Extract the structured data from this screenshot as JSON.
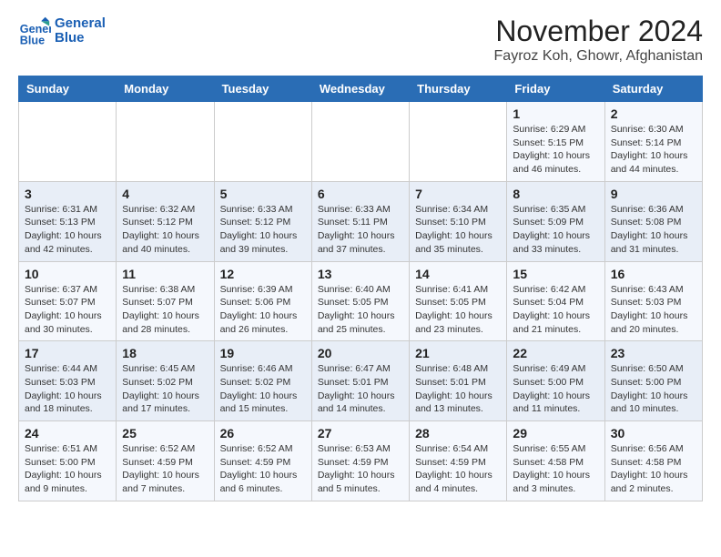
{
  "logo": {
    "line1": "General",
    "line2": "Blue"
  },
  "title": "November 2024",
  "location": "Fayroz Koh, Ghowr, Afghanistan",
  "days_of_week": [
    "Sunday",
    "Monday",
    "Tuesday",
    "Wednesday",
    "Thursday",
    "Friday",
    "Saturday"
  ],
  "weeks": [
    [
      {
        "day": "",
        "info": ""
      },
      {
        "day": "",
        "info": ""
      },
      {
        "day": "",
        "info": ""
      },
      {
        "day": "",
        "info": ""
      },
      {
        "day": "",
        "info": ""
      },
      {
        "day": "1",
        "info": "Sunrise: 6:29 AM\nSunset: 5:15 PM\nDaylight: 10 hours and 46 minutes."
      },
      {
        "day": "2",
        "info": "Sunrise: 6:30 AM\nSunset: 5:14 PM\nDaylight: 10 hours and 44 minutes."
      }
    ],
    [
      {
        "day": "3",
        "info": "Sunrise: 6:31 AM\nSunset: 5:13 PM\nDaylight: 10 hours and 42 minutes."
      },
      {
        "day": "4",
        "info": "Sunrise: 6:32 AM\nSunset: 5:12 PM\nDaylight: 10 hours and 40 minutes."
      },
      {
        "day": "5",
        "info": "Sunrise: 6:33 AM\nSunset: 5:12 PM\nDaylight: 10 hours and 39 minutes."
      },
      {
        "day": "6",
        "info": "Sunrise: 6:33 AM\nSunset: 5:11 PM\nDaylight: 10 hours and 37 minutes."
      },
      {
        "day": "7",
        "info": "Sunrise: 6:34 AM\nSunset: 5:10 PM\nDaylight: 10 hours and 35 minutes."
      },
      {
        "day": "8",
        "info": "Sunrise: 6:35 AM\nSunset: 5:09 PM\nDaylight: 10 hours and 33 minutes."
      },
      {
        "day": "9",
        "info": "Sunrise: 6:36 AM\nSunset: 5:08 PM\nDaylight: 10 hours and 31 minutes."
      }
    ],
    [
      {
        "day": "10",
        "info": "Sunrise: 6:37 AM\nSunset: 5:07 PM\nDaylight: 10 hours and 30 minutes."
      },
      {
        "day": "11",
        "info": "Sunrise: 6:38 AM\nSunset: 5:07 PM\nDaylight: 10 hours and 28 minutes."
      },
      {
        "day": "12",
        "info": "Sunrise: 6:39 AM\nSunset: 5:06 PM\nDaylight: 10 hours and 26 minutes."
      },
      {
        "day": "13",
        "info": "Sunrise: 6:40 AM\nSunset: 5:05 PM\nDaylight: 10 hours and 25 minutes."
      },
      {
        "day": "14",
        "info": "Sunrise: 6:41 AM\nSunset: 5:05 PM\nDaylight: 10 hours and 23 minutes."
      },
      {
        "day": "15",
        "info": "Sunrise: 6:42 AM\nSunset: 5:04 PM\nDaylight: 10 hours and 21 minutes."
      },
      {
        "day": "16",
        "info": "Sunrise: 6:43 AM\nSunset: 5:03 PM\nDaylight: 10 hours and 20 minutes."
      }
    ],
    [
      {
        "day": "17",
        "info": "Sunrise: 6:44 AM\nSunset: 5:03 PM\nDaylight: 10 hours and 18 minutes."
      },
      {
        "day": "18",
        "info": "Sunrise: 6:45 AM\nSunset: 5:02 PM\nDaylight: 10 hours and 17 minutes."
      },
      {
        "day": "19",
        "info": "Sunrise: 6:46 AM\nSunset: 5:02 PM\nDaylight: 10 hours and 15 minutes."
      },
      {
        "day": "20",
        "info": "Sunrise: 6:47 AM\nSunset: 5:01 PM\nDaylight: 10 hours and 14 minutes."
      },
      {
        "day": "21",
        "info": "Sunrise: 6:48 AM\nSunset: 5:01 PM\nDaylight: 10 hours and 13 minutes."
      },
      {
        "day": "22",
        "info": "Sunrise: 6:49 AM\nSunset: 5:00 PM\nDaylight: 10 hours and 11 minutes."
      },
      {
        "day": "23",
        "info": "Sunrise: 6:50 AM\nSunset: 5:00 PM\nDaylight: 10 hours and 10 minutes."
      }
    ],
    [
      {
        "day": "24",
        "info": "Sunrise: 6:51 AM\nSunset: 5:00 PM\nDaylight: 10 hours and 9 minutes."
      },
      {
        "day": "25",
        "info": "Sunrise: 6:52 AM\nSunset: 4:59 PM\nDaylight: 10 hours and 7 minutes."
      },
      {
        "day": "26",
        "info": "Sunrise: 6:52 AM\nSunset: 4:59 PM\nDaylight: 10 hours and 6 minutes."
      },
      {
        "day": "27",
        "info": "Sunrise: 6:53 AM\nSunset: 4:59 PM\nDaylight: 10 hours and 5 minutes."
      },
      {
        "day": "28",
        "info": "Sunrise: 6:54 AM\nSunset: 4:59 PM\nDaylight: 10 hours and 4 minutes."
      },
      {
        "day": "29",
        "info": "Sunrise: 6:55 AM\nSunset: 4:58 PM\nDaylight: 10 hours and 3 minutes."
      },
      {
        "day": "30",
        "info": "Sunrise: 6:56 AM\nSunset: 4:58 PM\nDaylight: 10 hours and 2 minutes."
      }
    ]
  ]
}
